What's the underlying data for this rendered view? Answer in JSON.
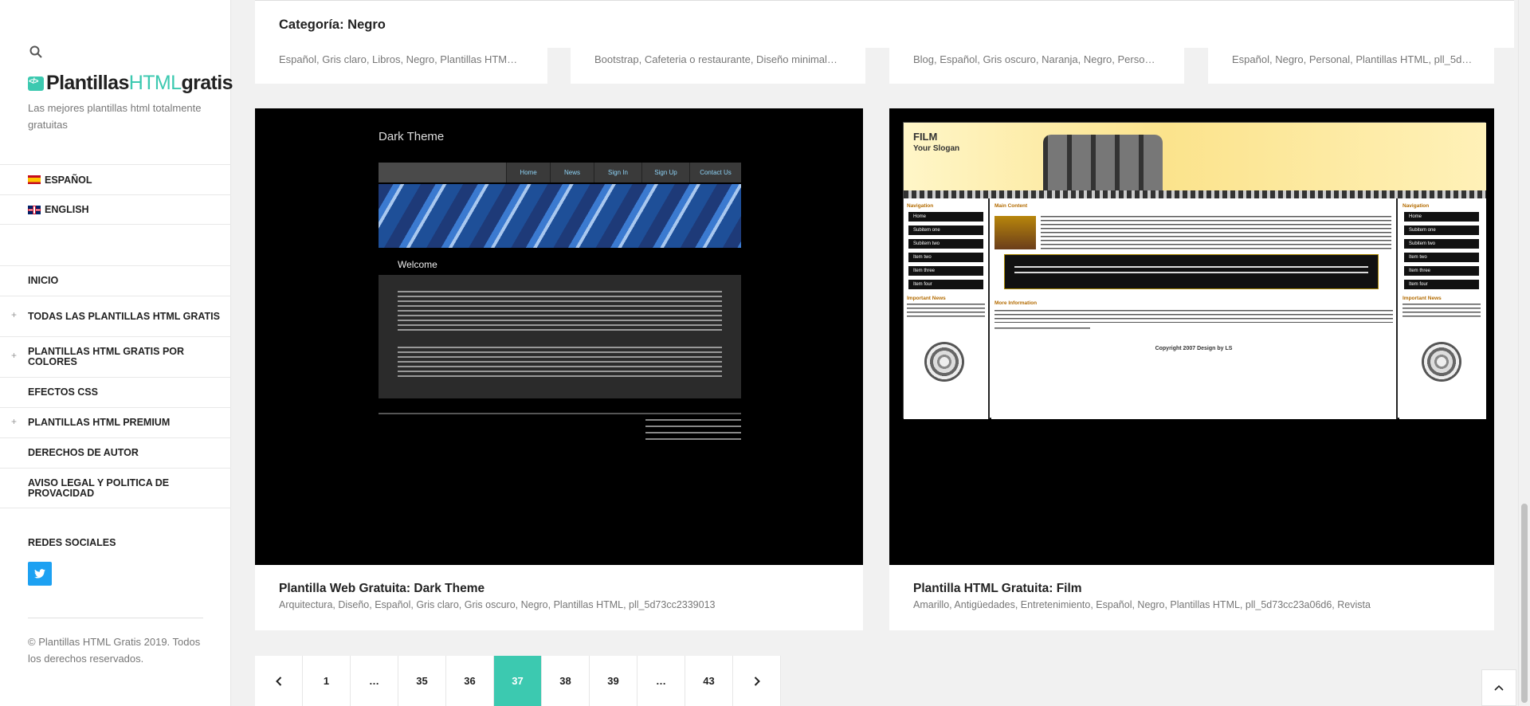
{
  "sidebar": {
    "logo_prefix": "Plantillas",
    "logo_accent": "HTML",
    "logo_suffix": "gratis",
    "tagline": "Las mejores plantillas html totalmente gratuitas",
    "languages": [
      {
        "label": "ESPAÑOL",
        "flag": "flag-es-icon"
      },
      {
        "label": "ENGLISH",
        "flag": "flag-gb-icon"
      }
    ],
    "menu": [
      {
        "label": "INICIO",
        "expandable": false
      },
      {
        "label": "TODAS LAS PLANTILLAS HTML GRATIS",
        "expandable": true
      },
      {
        "label": "PLANTILLAS HTML GRATIS POR COLORES",
        "expandable": true
      },
      {
        "label": "EFECTOS CSS",
        "expandable": false
      },
      {
        "label": "PLANTILLAS HTML PREMIUM",
        "expandable": true
      },
      {
        "label": "DERECHOS DE AUTOR",
        "expandable": false
      },
      {
        "label": "AVISO LEGAL Y POLITICA DE PROVACIDAD",
        "expandable": false
      }
    ],
    "social_title": "REDES SOCIALES",
    "copyright": "© Plantillas HTML Gratis 2019. Todos los derechos reservados."
  },
  "header": {
    "category_title": "Categoría: Negro"
  },
  "top_cards": [
    {
      "tags": "Español, Gris claro, Libros, Negro, Plantillas HTM…"
    },
    {
      "tags": "Bootstrap, Cafeteria o restaurante, Diseño minimal…"
    },
    {
      "tags": "Blog, Español, Gris oscuro, Naranja, Negro, Perso…"
    },
    {
      "tags": "Español, Negro, Personal, Plantillas HTML, pll_5d…"
    }
  ],
  "cards": [
    {
      "title": "Plantilla Web Gratuita: Dark Theme",
      "tags": "Arquitectura, Diseño, Español, Gris claro, Gris oscuro, Negro, Plantillas HTML, pll_5d73cc2339013",
      "preview": {
        "site_title": "Dark Theme",
        "nav": [
          "Home",
          "News",
          "Sign In",
          "Sign Up",
          "Contact Us"
        ],
        "welcome": "Welcome"
      }
    },
    {
      "title": "Plantilla HTML Gratuita: Film",
      "tags": "Amarillo, Antigüedades, Entretenimiento, Español, Negro, Plantillas HTML, pll_5d73cc23a06d6, Revista",
      "preview": {
        "site_title": "FILM",
        "slogan": "Your Slogan",
        "nav_label": "Navigation",
        "main_label": "Main Content",
        "more_label": "More Information",
        "news_label": "Important News",
        "nav": [
          "Home",
          "Subitem one",
          "Subitem two",
          "Item two",
          "Item three",
          "Item four"
        ],
        "copyright": "Copyright 2007 Design by LS"
      }
    }
  ],
  "pagination": {
    "prev": "‹",
    "pages": [
      "1",
      "…",
      "35",
      "36",
      "37",
      "38",
      "39",
      "…",
      "43"
    ],
    "current": "37",
    "next": "›"
  },
  "colors": {
    "accent": "#3cc9b0",
    "twitter": "#1da1f2"
  }
}
